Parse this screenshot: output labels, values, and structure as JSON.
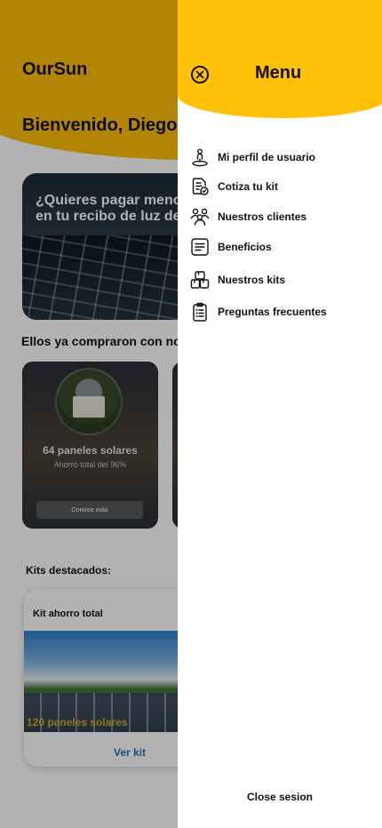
{
  "app": {
    "brand": "OurSun",
    "welcome": "Bienvenido, Diego"
  },
  "promo": {
    "text": "¿Quieres pagar menos\nen tu recibo de luz de"
  },
  "clients": {
    "title": "Ellos ya compraron con no",
    "cards": [
      {
        "panels": "64 paneles solares",
        "saving": "Ahorro total del 96%",
        "button": "Conoce más"
      }
    ]
  },
  "kits": {
    "title": "Kits destacados:",
    "cards": [
      {
        "name": "Kit ahorro total",
        "panels": "120 paneles solares",
        "link": "Ver kit"
      }
    ]
  },
  "drawer": {
    "title": "Menu",
    "close_icon": "close-circle-icon",
    "items": [
      {
        "label": "Mi perfil de usuario",
        "icon": "user-pin-icon"
      },
      {
        "label": "Cotiza tu kit",
        "icon": "quote-document-icon"
      },
      {
        "label": "Nuestros clientes",
        "icon": "users-icon"
      },
      {
        "label": "Beneficios",
        "icon": "list-icon"
      },
      {
        "label": "Nuestros kits",
        "icon": "boxes-icon"
      },
      {
        "label": "Preguntas frecuentes",
        "icon": "clipboard-icon"
      }
    ],
    "logout": "Close sesion"
  },
  "colors": {
    "accent": "#ffc107",
    "link": "#2a6fb0",
    "scrim": "rgba(0,0,0,0.3)"
  }
}
